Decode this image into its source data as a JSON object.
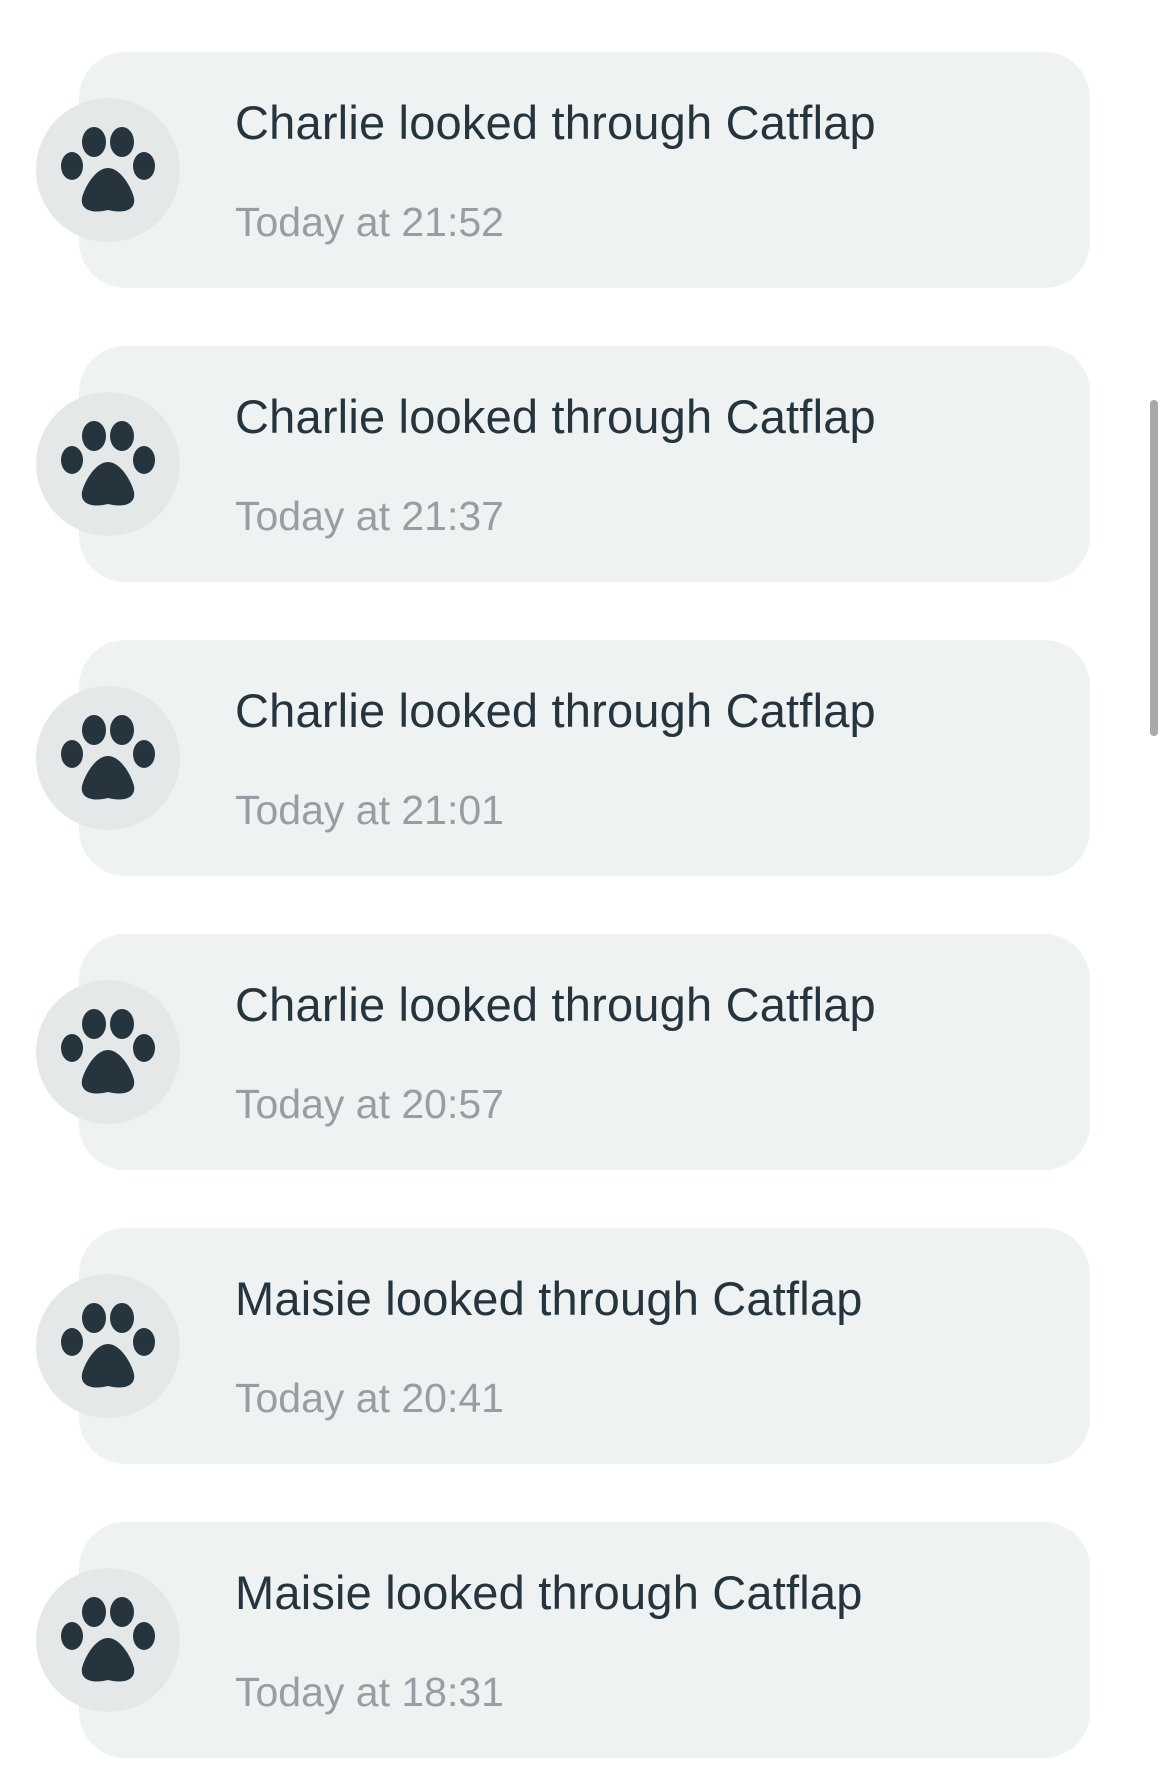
{
  "events": [
    {
      "title": "Charlie looked through Catflap",
      "time": "Today at 21:52",
      "icon": "paw-icon"
    },
    {
      "title": "Charlie looked through Catflap",
      "time": "Today at 21:37",
      "icon": "paw-icon"
    },
    {
      "title": "Charlie looked through Catflap",
      "time": "Today at 21:01",
      "icon": "paw-icon"
    },
    {
      "title": "Charlie looked through Catflap",
      "time": "Today at 20:57",
      "icon": "paw-icon"
    },
    {
      "title": "Maisie looked through Catflap",
      "time": "Today at 20:41",
      "icon": "paw-icon"
    },
    {
      "title": "Maisie looked through Catflap",
      "time": "Today at 18:31",
      "icon": "paw-icon"
    }
  ],
  "colors": {
    "card_background": "#eff2f3",
    "avatar_background": "#e5e8e9",
    "icon": "#25343d",
    "title_text": "#25343d",
    "time_text": "#979ea3",
    "scrollbar": "#a7a9ab"
  }
}
